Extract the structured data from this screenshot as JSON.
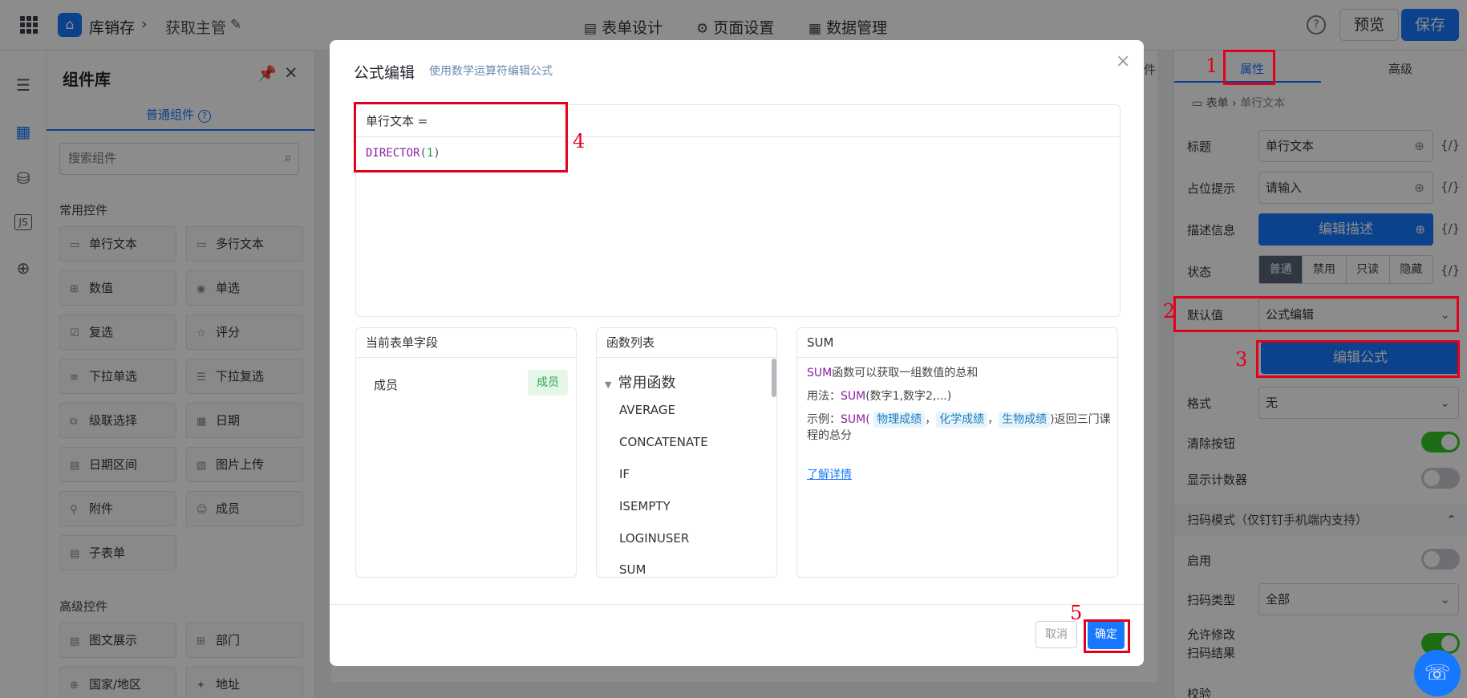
{
  "topbar": {
    "app_name": "库销存",
    "page_name": "获取主管",
    "nav": [
      "表单设计",
      "页面设置",
      "数据管理"
    ],
    "help": "?",
    "preview": "预览",
    "save": "保存"
  },
  "library": {
    "title": "组件库",
    "tab": "普通组件",
    "search_placeholder": "搜索组件",
    "common_title": "常用控件",
    "common": [
      [
        "单行文本",
        "多行文本"
      ],
      [
        "数值",
        "单选"
      ],
      [
        "复选",
        "评分"
      ],
      [
        "下拉单选",
        "下拉复选"
      ],
      [
        "级联选择",
        "日期"
      ],
      [
        "日期区间",
        "图片上传"
      ],
      [
        "附件",
        "成员"
      ],
      [
        "子表单"
      ]
    ],
    "advanced_title": "高级控件",
    "advanced": [
      [
        "图文展示",
        "部门"
      ],
      [
        "国家/地区",
        "地址"
      ]
    ]
  },
  "canvas": {
    "tab_partial": "件"
  },
  "right": {
    "tab_attr": "属性",
    "tab_adv": "高级",
    "crumb_form": "表单",
    "crumb_field": "单行文本",
    "title_label": "标题",
    "title_value": "单行文本",
    "placeholder_label": "占位提示",
    "placeholder_value": "请输入",
    "desc_label": "描述信息",
    "desc_btn": "编辑描述",
    "state_label": "状态",
    "states": [
      "普通",
      "禁用",
      "只读",
      "隐藏"
    ],
    "default_label": "默认值",
    "default_value": "公式编辑",
    "formula_btn": "编辑公式",
    "format_label": "格式",
    "format_value": "无",
    "clear_label": "清除按钮",
    "counter_label": "显示计数器",
    "scan_section": "扫码模式（仅钉钉手机端内支持）",
    "enable_label": "启用",
    "scan_type_label": "扫码类型",
    "scan_type_value": "全部",
    "allow_edit_1": "允许修改",
    "allow_edit_2": "扫码结果",
    "verify_label": "校验",
    "fx": "{/}"
  },
  "modal": {
    "title": "公式编辑",
    "subtitle": "使用数学运算符编辑公式",
    "editor_head": "单行文本 =",
    "code_fn": "DIRECTOR",
    "code_open": "(",
    "code_num": "1",
    "code_close": ")",
    "fields_title": "当前表单字段",
    "field_name": "成员",
    "field_badge": "成员",
    "funcs_title": "函数列表",
    "func_group": "常用函数",
    "funcs": [
      "AVERAGE",
      "CONCATENATE",
      "IF",
      "ISEMPTY",
      "LOGINUSER",
      "SUM"
    ],
    "doc_title": "SUM",
    "doc_fn": "SUM",
    "doc_desc": "函数可以获取一组数值的总和",
    "usage_label": "用法：",
    "usage_fn": "SUM",
    "usage_args": "(数字1,数字2,...)",
    "example_label": "示例：",
    "example_fn": "SUM(",
    "example_tags": [
      "物理成绩",
      "化学成绩",
      "生物成绩"
    ],
    "example_comma": "，",
    "example_end": ")返回三门课程的总分",
    "learn_more": "了解详情",
    "cancel": "取消",
    "ok": "确定"
  },
  "annotations": [
    "1",
    "2",
    "3",
    "4",
    "5"
  ],
  "colors": {
    "primary": "#1677ff",
    "annotation": "#e3001b",
    "success": "#34c724"
  }
}
